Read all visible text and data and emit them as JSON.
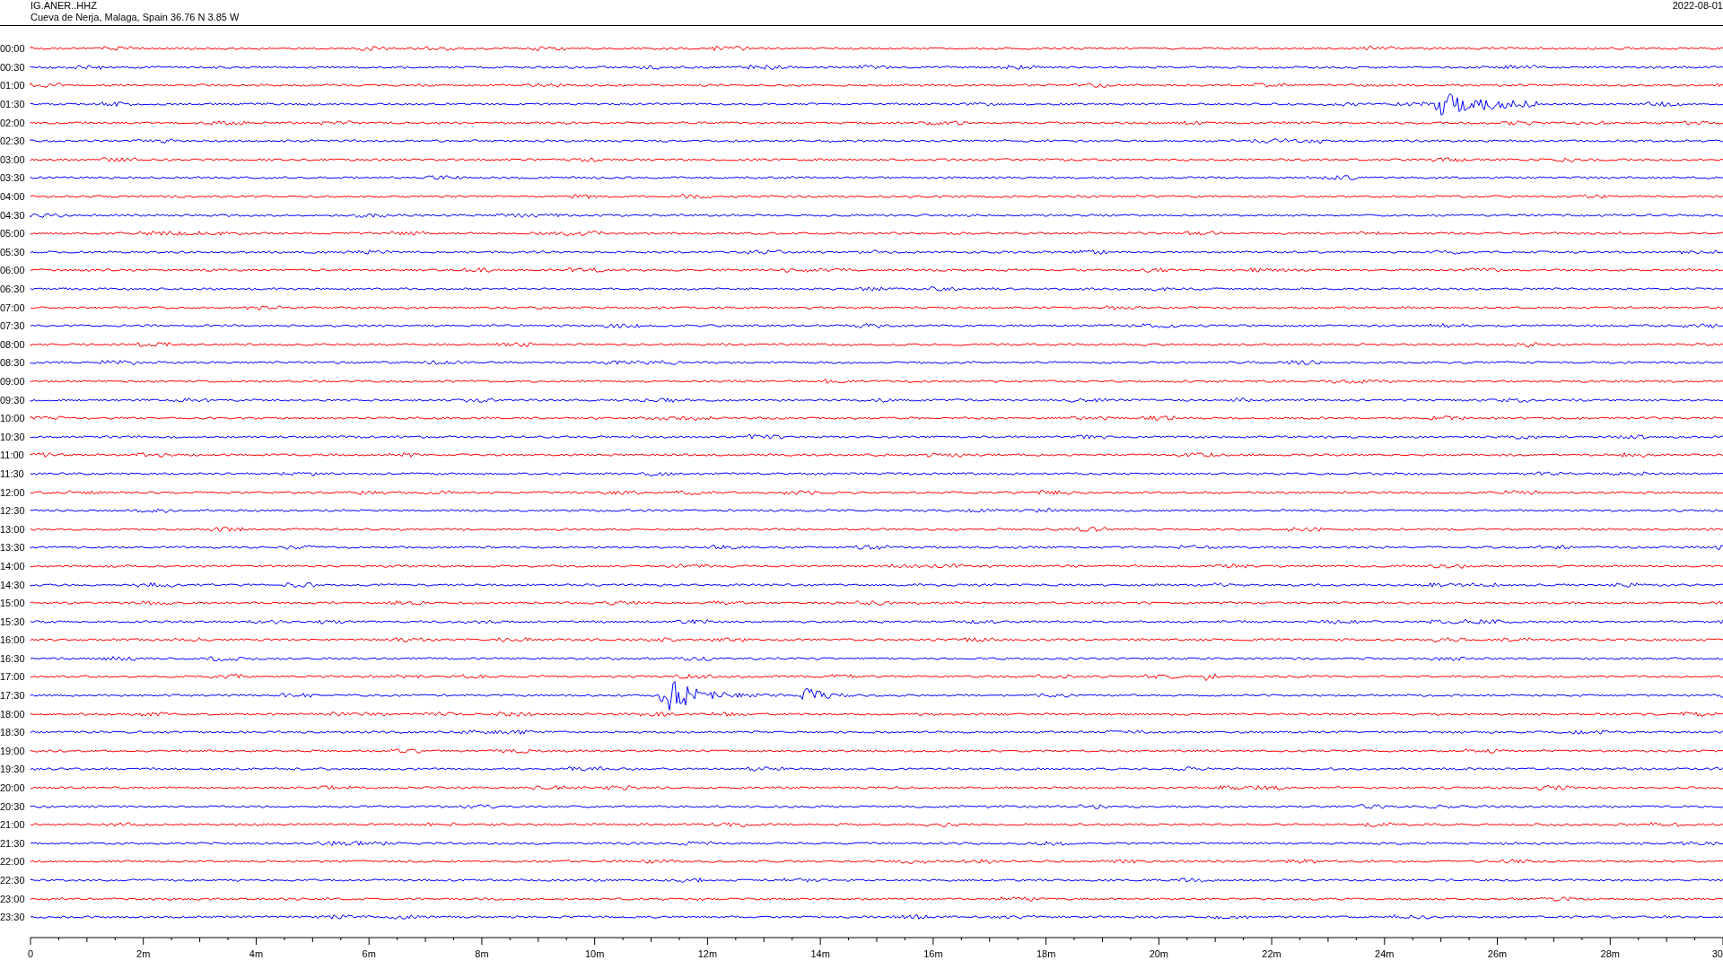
{
  "header": {
    "station": "IG.ANER..HHZ",
    "location": "Cueva de Nerja, Malaga, Spain  36.76 N 3.85 W",
    "date": "2022-08-01"
  },
  "traces": [
    {
      "time": "00:00",
      "color": "#ff0000"
    },
    {
      "time": "00:30",
      "color": "#0000ff"
    },
    {
      "time": "01:00",
      "color": "#ff0000"
    },
    {
      "time": "01:30",
      "color": "#0000ff"
    },
    {
      "time": "02:00",
      "color": "#ff0000"
    },
    {
      "time": "02:30",
      "color": "#0000ff"
    },
    {
      "time": "03:00",
      "color": "#ff0000"
    },
    {
      "time": "03:30",
      "color": "#0000ff"
    },
    {
      "time": "04:00",
      "color": "#ff0000"
    },
    {
      "time": "04:30",
      "color": "#0000ff"
    },
    {
      "time": "05:00",
      "color": "#ff0000"
    },
    {
      "time": "05:30",
      "color": "#0000ff"
    },
    {
      "time": "06:00",
      "color": "#ff0000"
    },
    {
      "time": "06:30",
      "color": "#0000ff"
    },
    {
      "time": "07:00",
      "color": "#ff0000"
    },
    {
      "time": "07:30",
      "color": "#0000ff"
    },
    {
      "time": "08:00",
      "color": "#ff0000"
    },
    {
      "time": "08:30",
      "color": "#0000ff"
    },
    {
      "time": "09:00",
      "color": "#ff0000"
    },
    {
      "time": "09:30",
      "color": "#0000ff"
    },
    {
      "time": "10:00",
      "color": "#ff0000"
    },
    {
      "time": "10:30",
      "color": "#0000ff"
    },
    {
      "time": "11:00",
      "color": "#ff0000"
    },
    {
      "time": "11:30",
      "color": "#0000ff"
    },
    {
      "time": "12:00",
      "color": "#ff0000"
    },
    {
      "time": "12:30",
      "color": "#0000ff"
    },
    {
      "time": "13:00",
      "color": "#ff0000"
    },
    {
      "time": "13:30",
      "color": "#0000ff"
    },
    {
      "time": "14:00",
      "color": "#ff0000"
    },
    {
      "time": "14:30",
      "color": "#0000ff"
    },
    {
      "time": "15:00",
      "color": "#ff0000"
    },
    {
      "time": "15:30",
      "color": "#0000ff"
    },
    {
      "time": "16:00",
      "color": "#ff0000"
    },
    {
      "time": "16:30",
      "color": "#0000ff"
    },
    {
      "time": "17:00",
      "color": "#ff0000"
    },
    {
      "time": "17:30",
      "color": "#0000ff"
    },
    {
      "time": "18:00",
      "color": "#ff0000"
    },
    {
      "time": "18:30",
      "color": "#0000ff"
    },
    {
      "time": "19:00",
      "color": "#ff0000"
    },
    {
      "time": "19:30",
      "color": "#0000ff"
    },
    {
      "time": "20:00",
      "color": "#ff0000"
    },
    {
      "time": "20:30",
      "color": "#0000ff"
    },
    {
      "time": "21:00",
      "color": "#ff0000"
    },
    {
      "time": "21:30",
      "color": "#0000ff"
    },
    {
      "time": "22:00",
      "color": "#ff0000"
    },
    {
      "time": "22:30",
      "color": "#0000ff"
    },
    {
      "time": "23:00",
      "color": "#ff0000"
    },
    {
      "time": "23:30",
      "color": "#0000ff"
    }
  ],
  "x_axis": {
    "labels": [
      "0",
      "2m",
      "4m",
      "6m",
      "8m",
      "10m",
      "12m",
      "14m",
      "16m",
      "18m",
      "20m",
      "22m",
      "24m",
      "26m",
      "28m",
      "30"
    ]
  }
}
